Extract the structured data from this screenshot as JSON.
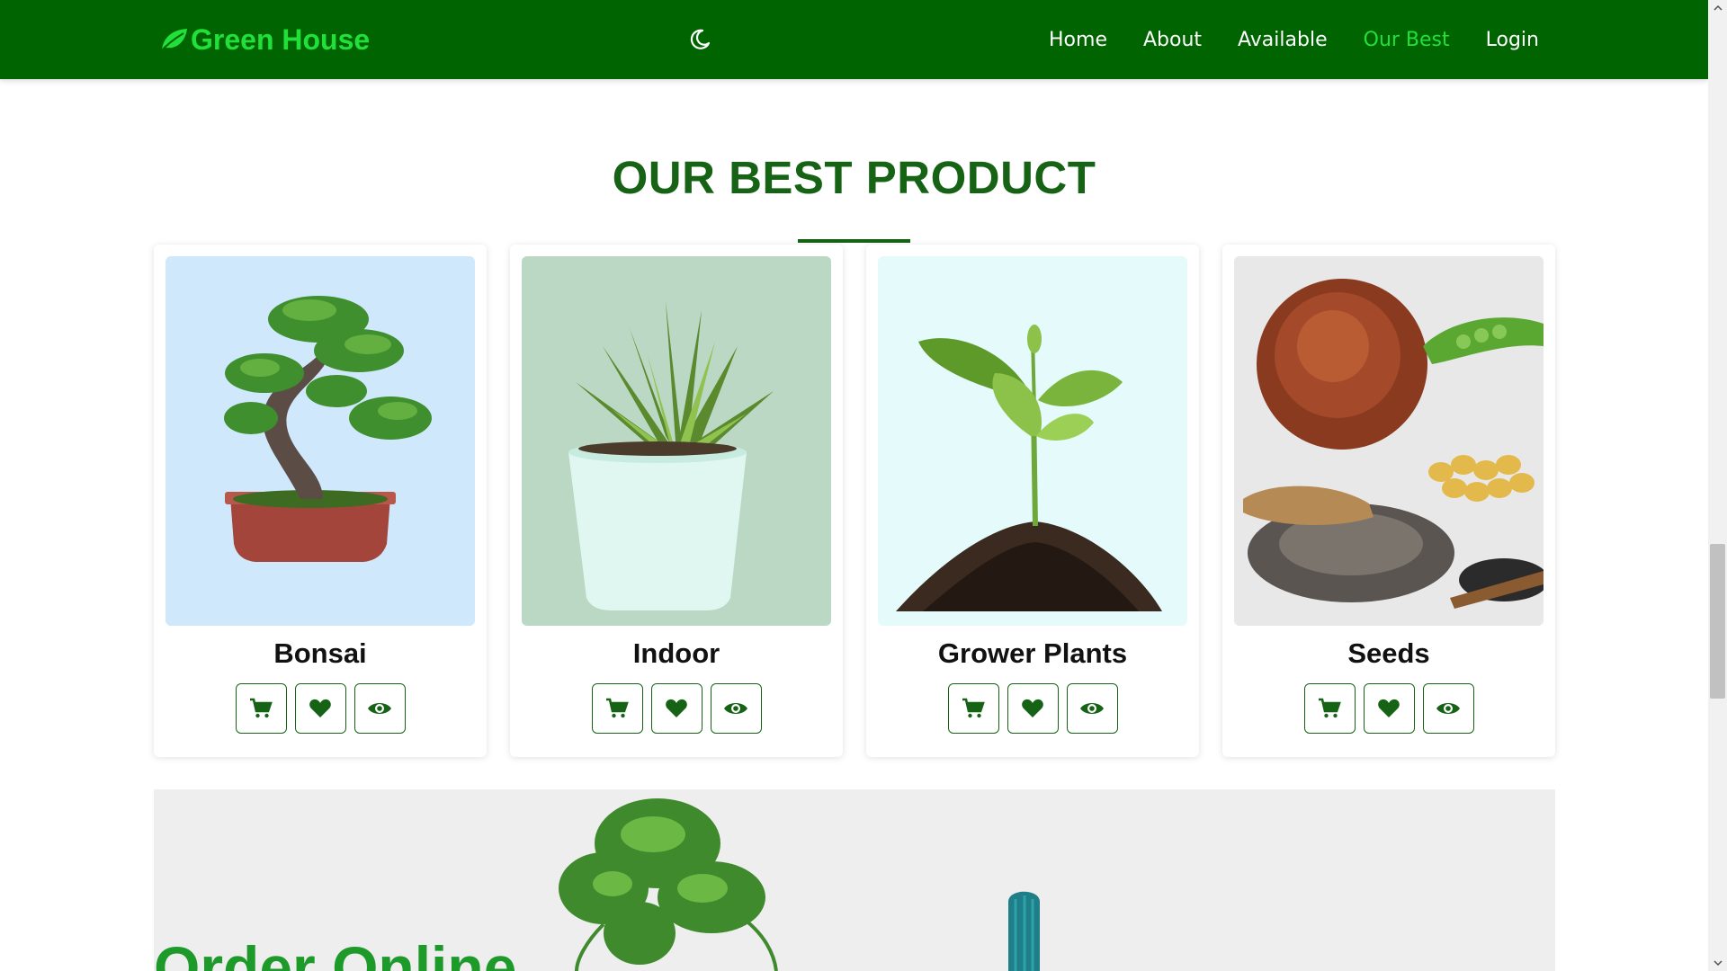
{
  "navbar": {
    "brand": "Green House",
    "links": [
      {
        "label": "Home",
        "active": false
      },
      {
        "label": "About",
        "active": false
      },
      {
        "label": "Available",
        "active": false
      },
      {
        "label": "Our Best",
        "active": true
      },
      {
        "label": "Login",
        "active": false
      }
    ]
  },
  "section": {
    "title": "OUR BEST PRODUCT"
  },
  "products": [
    {
      "name": "Bonsai",
      "image": "bonsai-tree",
      "bg": "#cfe8fb"
    },
    {
      "name": "Indoor",
      "image": "succulent-pot",
      "bg": "#bad8c3"
    },
    {
      "name": "Grower Plants",
      "image": "seedling-soil",
      "bg": "#e5fbfb"
    },
    {
      "name": "Seeds",
      "image": "seeds-assortment",
      "bg": "#e8e8e8"
    }
  ],
  "actions": [
    "cart-icon",
    "heart-icon",
    "eye-icon"
  ],
  "banner": {
    "title": "Order Online"
  },
  "colors": {
    "nav_bg": "#006400",
    "accent": "#22e03a",
    "primary": "#166316"
  }
}
